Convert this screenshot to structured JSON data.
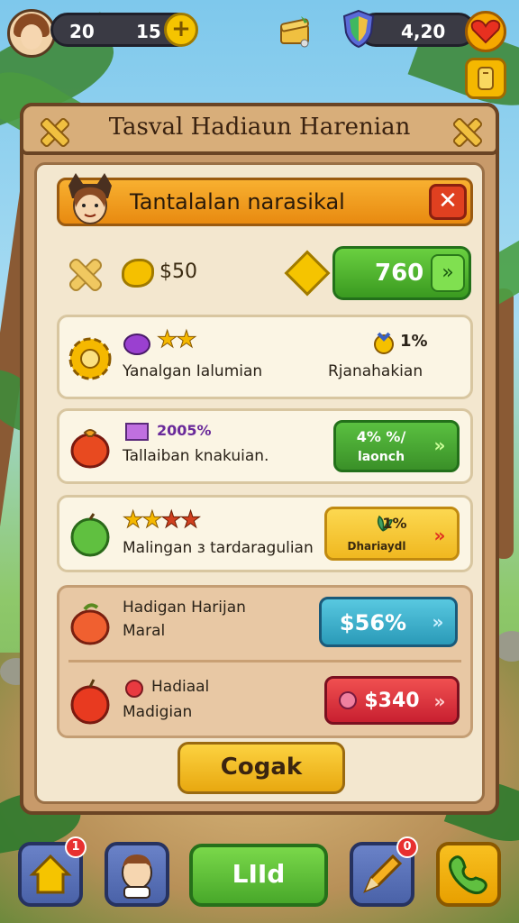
{
  "hud": {
    "value_left": "20",
    "value_right": "15",
    "plus": "+",
    "value_gems": "4,20"
  },
  "panel": {
    "title": "Tasval Hadiaun Harenian"
  },
  "banner": {
    "title": "Tantalalan narasikal",
    "close": "✕"
  },
  "stats": {
    "coin_value": "$50",
    "green_value": "760",
    "green_arrow": "»"
  },
  "cards": [
    {
      "main_text": "Yanalgan Ialumian",
      "pct": "1%",
      "sub_text": "Rjanahakian"
    },
    {
      "pct_label": "2005%",
      "main_text": "Tallaiban knakuian.",
      "btn_top": "4% %/",
      "btn_bottom": "laonch",
      "chev": "»"
    },
    {
      "main_text": "Malingan з tardaragulian",
      "pct": "1%",
      "btn_bottom": "Dhariaydl",
      "chev": "»"
    }
  ],
  "lower": [
    {
      "line1": "Hadigan Harijan",
      "line2": "Maral",
      "btn": "$56%",
      "chev": "»"
    },
    {
      "line1": "Hadiaal",
      "line2": "Madigian",
      "btn": "$340",
      "chev": "»"
    }
  ],
  "action_button": "Cogak",
  "nav": {
    "main": "LIId",
    "badge_home": "1",
    "badge_edit": "0"
  },
  "colors": {
    "accent_orange": "#e88a10",
    "green": "#3a9a20",
    "teal": "#2aa0c0",
    "red": "#d02030",
    "yellow": "#f5c400"
  }
}
